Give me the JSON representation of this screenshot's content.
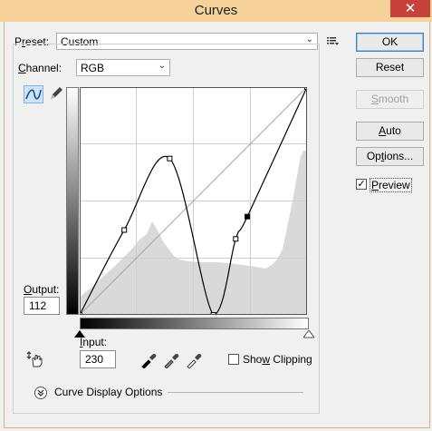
{
  "window": {
    "title": "Curves",
    "close_glyph": "✕"
  },
  "preset": {
    "label_pre": "P",
    "label_ul": "r",
    "label_post": "eset:",
    "value": "Custom",
    "menu_icon": "preset-options-icon"
  },
  "channel": {
    "label_pre": "",
    "label_ul": "C",
    "label_post": "hannel:",
    "value": "RGB"
  },
  "buttons": {
    "ok": "OK",
    "reset": "Reset",
    "smooth_pre": "",
    "smooth_ul": "S",
    "smooth_post": "mooth",
    "auto_pre": "",
    "auto_ul": "A",
    "auto_post": "uto",
    "options_pre": "Op",
    "options_ul": "t",
    "options_post": "ions..."
  },
  "preview": {
    "label_pre": "",
    "label_ul": "P",
    "label_post": "review",
    "checked": true
  },
  "output": {
    "label_pre": "",
    "label_ul": "O",
    "label_post": "utput:",
    "value": "112"
  },
  "input": {
    "label_pre": "",
    "label_ul": "I",
    "label_post": "nput:",
    "value": "230"
  },
  "show_clipping": {
    "label_pre": "Sho",
    "label_ul": "w",
    "label_post": " Clipping",
    "checked": false
  },
  "curve_display": {
    "label": "Curve Display Options"
  },
  "icons": {
    "curve_tool": "curve-point-icon",
    "pencil_tool": "pencil-icon",
    "targeted_adjust": "hand-adjust-icon",
    "black_eyedropper": "black-eyedropper-icon",
    "gray_eyedropper": "gray-eyedropper-icon",
    "white_eyedropper": "white-eyedropper-icon"
  },
  "colors": {
    "accent": "#3c7fb1",
    "titlebar": "#f5d29a",
    "close": "#c7413a",
    "histogram": "#d9d9d9"
  },
  "curve": {
    "points": [
      [
        0,
        0
      ],
      [
        50,
        95
      ],
      [
        101,
        175
      ],
      [
        150,
        0
      ],
      [
        175,
        85
      ],
      [
        188,
        110
      ],
      [
        255,
        255
      ]
    ]
  }
}
